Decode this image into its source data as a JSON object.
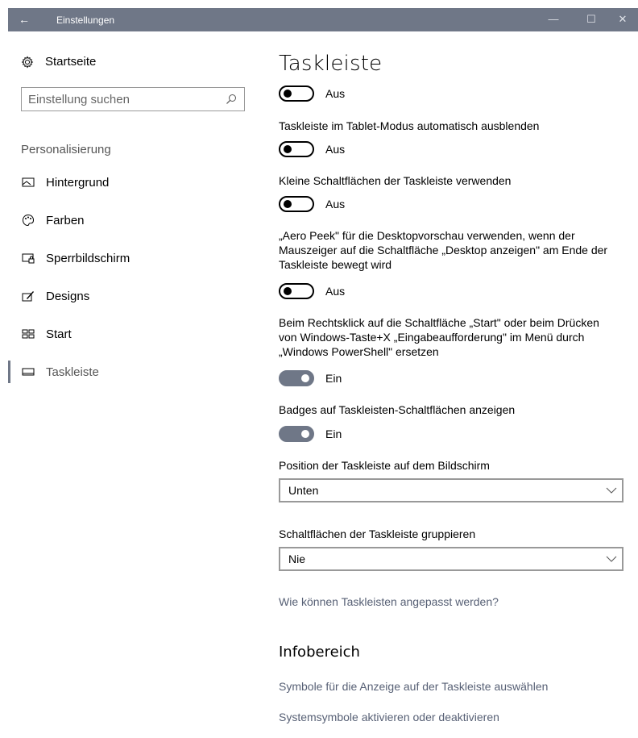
{
  "window": {
    "title": "Einstellungen",
    "back_glyph": "←",
    "minimize_glyph": "—",
    "maximize_glyph": "☐",
    "close_glyph": "✕",
    "titlebar_color": "#6f7787"
  },
  "sidebar": {
    "home_label": "Startseite",
    "home_icon": "gear-icon",
    "search_placeholder": "Einstellung suchen",
    "search_icon": "search-icon",
    "section_label": "Personalisierung",
    "items": [
      {
        "label": "Hintergrund",
        "icon": "picture-icon"
      },
      {
        "label": "Farben",
        "icon": "palette-icon"
      },
      {
        "label": "Sperrbildschirm",
        "icon": "lock-screen-icon"
      },
      {
        "label": "Designs",
        "icon": "brush-icon"
      },
      {
        "label": "Start",
        "icon": "start-tiles-icon"
      },
      {
        "label": "Taskleiste",
        "icon": "taskbar-icon",
        "active": true
      }
    ]
  },
  "main": {
    "title": "Taskleiste",
    "settings": [
      {
        "label": "",
        "state_label": "Aus",
        "on": false
      },
      {
        "label": "Taskleiste im Tablet-Modus automatisch ausblenden",
        "state_label": "Aus",
        "on": false
      },
      {
        "label": "Kleine Schaltflächen der Taskleiste verwenden",
        "state_label": "Aus",
        "on": false
      },
      {
        "label": "„Aero Peek\" für die Desktopvorschau verwenden, wenn der Mauszeiger auf die Schaltfläche „Desktop anzeigen\" am Ende der Taskleiste bewegt wird",
        "state_label": "Aus",
        "on": false
      },
      {
        "label": "Beim Rechtsklick auf die Schaltfläche „Start\" oder beim Drücken von Windows-Taste+X „Eingabeaufforderung\" im Menü durch „Windows PowerShell\" ersetzen",
        "state_label": "Ein",
        "on": true
      },
      {
        "label": "Badges auf Taskleisten-Schaltflächen anzeigen",
        "state_label": "Ein",
        "on": true
      }
    ],
    "position_label": "Position der Taskleiste auf dem Bildschirm",
    "position_value": "Unten",
    "group_label": "Schaltflächen der Taskleiste gruppieren",
    "group_value": "Nie",
    "help_link": "Wie können Taskleisten angepasst werden?",
    "notification_area_title": "Infobereich",
    "links": [
      "Symbole für die Anzeige auf der Taskleiste auswählen",
      "Systemsymbole aktivieren oder deaktivieren"
    ]
  }
}
